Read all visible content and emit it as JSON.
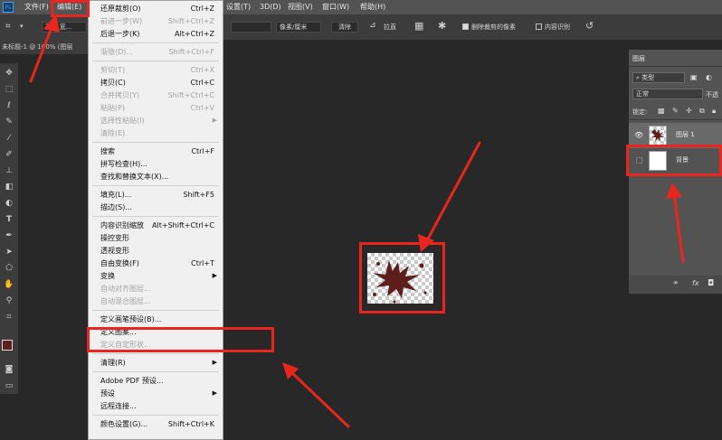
{
  "menubar": {
    "logo": "Ps",
    "items": [
      "文件(F)",
      "编辑(E)",
      "设置(T)",
      "3D(D)",
      "视图(V)",
      "窗口(W)",
      "帮助(H)"
    ]
  },
  "options": {
    "unit_select": "像素/厘米",
    "clear_button": "清除",
    "straighten_label": "拉直",
    "delete_cropped_label": "删除裁剪的像素",
    "content_aware_label": "内容识别",
    "left_partial": "高 x 宽..."
  },
  "doc_tab": {
    "title": "未标题-1 @ 100% (图层"
  },
  "edit_menu": {
    "items": [
      {
        "label": "还原裁剪(O)",
        "shortcut": "Ctrl+Z",
        "disabled": false
      },
      {
        "label": "前进一步(W)",
        "shortcut": "Shift+Ctrl+Z",
        "disabled": true
      },
      {
        "label": "后退一步(K)",
        "shortcut": "Alt+Ctrl+Z",
        "disabled": false
      },
      {
        "sep": true
      },
      {
        "label": "渐隐(D)...",
        "shortcut": "Shift+Ctrl+F",
        "disabled": true
      },
      {
        "sep": true
      },
      {
        "label": "剪切(T)",
        "shortcut": "Ctrl+X",
        "disabled": true
      },
      {
        "label": "拷贝(C)",
        "shortcut": "Ctrl+C",
        "disabled": false
      },
      {
        "label": "合并拷贝(Y)",
        "shortcut": "Shift+Ctrl+C",
        "disabled": true
      },
      {
        "label": "粘贴(P)",
        "shortcut": "Ctrl+V",
        "disabled": true
      },
      {
        "label": "选择性粘贴(I)",
        "submenu": true,
        "disabled": true
      },
      {
        "label": "清除(E)",
        "disabled": true
      },
      {
        "sep": true
      },
      {
        "label": "搜索",
        "shortcut": "Ctrl+F",
        "disabled": false
      },
      {
        "label": "拼写检查(H)...",
        "disabled": false
      },
      {
        "label": "查找和替换文本(X)...",
        "disabled": false
      },
      {
        "sep": true
      },
      {
        "label": "填充(L)...",
        "shortcut": "Shift+F5",
        "disabled": false
      },
      {
        "label": "描边(S)...",
        "disabled": false
      },
      {
        "sep": true
      },
      {
        "label": "内容识别缩放",
        "shortcut": "Alt+Shift+Ctrl+C",
        "disabled": false
      },
      {
        "label": "操控变形",
        "disabled": false
      },
      {
        "label": "透视变形",
        "disabled": false
      },
      {
        "label": "自由变换(F)",
        "shortcut": "Ctrl+T",
        "disabled": false
      },
      {
        "label": "变换",
        "submenu": true,
        "disabled": false
      },
      {
        "label": "自动对齐图层...",
        "disabled": true
      },
      {
        "label": "自动混合图层...",
        "disabled": true
      },
      {
        "sep": true
      },
      {
        "label": "定义画笔预设(B)...",
        "disabled": false
      },
      {
        "label": "定义图案...",
        "disabled": false
      },
      {
        "label": "定义自定形状...",
        "disabled": true
      },
      {
        "sep": true
      },
      {
        "label": "清理(R)",
        "submenu": true,
        "disabled": false
      },
      {
        "sep": true
      },
      {
        "label": "Adobe PDF 预设...",
        "disabled": false
      },
      {
        "label": "预设",
        "submenu": true,
        "disabled": false
      },
      {
        "label": "远程连接...",
        "disabled": false
      },
      {
        "sep": true
      },
      {
        "label": "颜色设置(G)...",
        "shortcut": "Shift+Ctrl+K",
        "disabled": false
      }
    ]
  },
  "layers_panel": {
    "tab": "图层",
    "filter_select": "类型",
    "blend_mode": "正常",
    "opacity_label": "不透",
    "lock_label": "锁定:",
    "layers": [
      {
        "name": "图层 1",
        "visible": true,
        "selected": true
      },
      {
        "name": "背景",
        "visible": false,
        "selected": false
      }
    ],
    "footer_icons": [
      "link-icon",
      "fx-icon",
      "mask-icon"
    ],
    "fx_label": "fx"
  },
  "toolbar_icons": [
    "move-icon",
    "marquee-icon",
    "lasso-icon",
    "quick-select-icon",
    "crop-icon",
    "eyedropper-icon",
    "brush-icon",
    "stamp-icon",
    "eraser-icon",
    "bucket-icon",
    "type-icon",
    "pen-icon",
    "path-select-icon",
    "shape-icon",
    "hand-icon",
    "zoom-icon"
  ],
  "colors": {
    "annotation_red": "#e8261e",
    "splatter": "#5e1f1c",
    "canvas_bg": "#282828"
  }
}
